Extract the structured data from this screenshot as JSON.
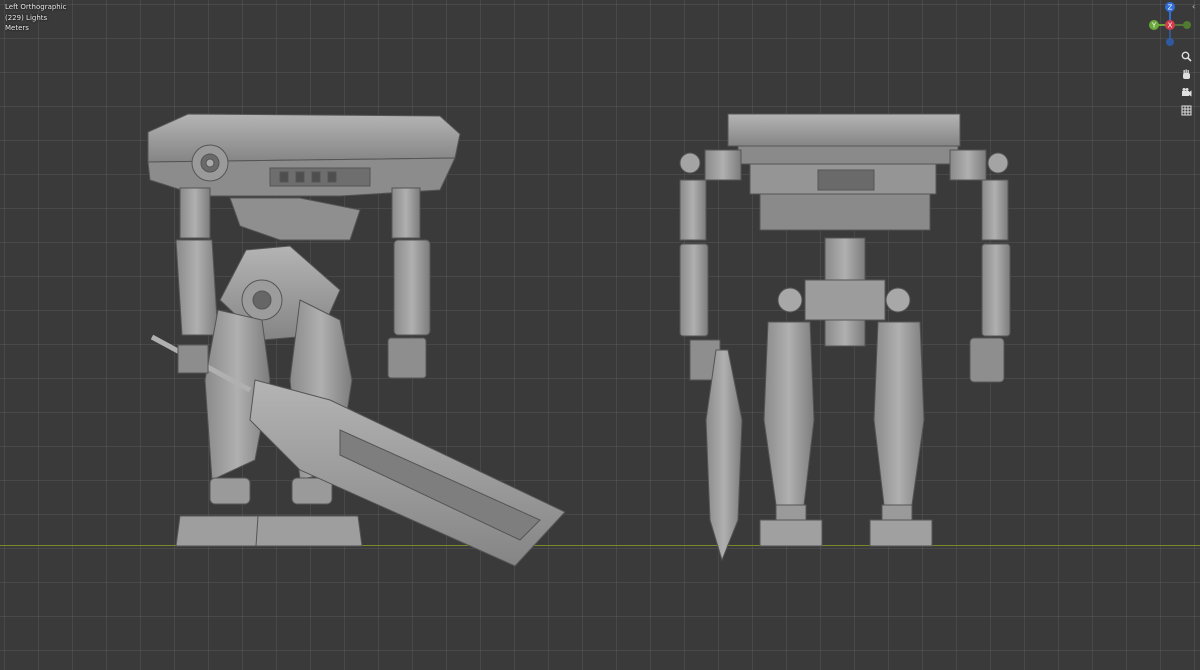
{
  "viewport": {
    "view_name": "Left Orthographic",
    "collection_info": "(229) Lights",
    "units": "Meters",
    "colors": {
      "background": "#3a3a3a",
      "grid": "#4a4a4a",
      "horizon": "#7a8a2a",
      "model": "#9a9a9a"
    }
  },
  "gizmo": {
    "axis_z": "Z",
    "axis_x": "X",
    "axis_y": "Y",
    "colors": {
      "z": "#2f6fd6",
      "x": "#d33a4a",
      "y": "#6aa83a"
    }
  },
  "nav_tools": [
    {
      "icon": "zoom-icon"
    },
    {
      "icon": "hand-pan-icon"
    },
    {
      "icon": "camera-icon"
    },
    {
      "icon": "grid-ortho-icon"
    }
  ],
  "models": [
    {
      "name": "robot-side-view"
    },
    {
      "name": "robot-front-view"
    }
  ]
}
